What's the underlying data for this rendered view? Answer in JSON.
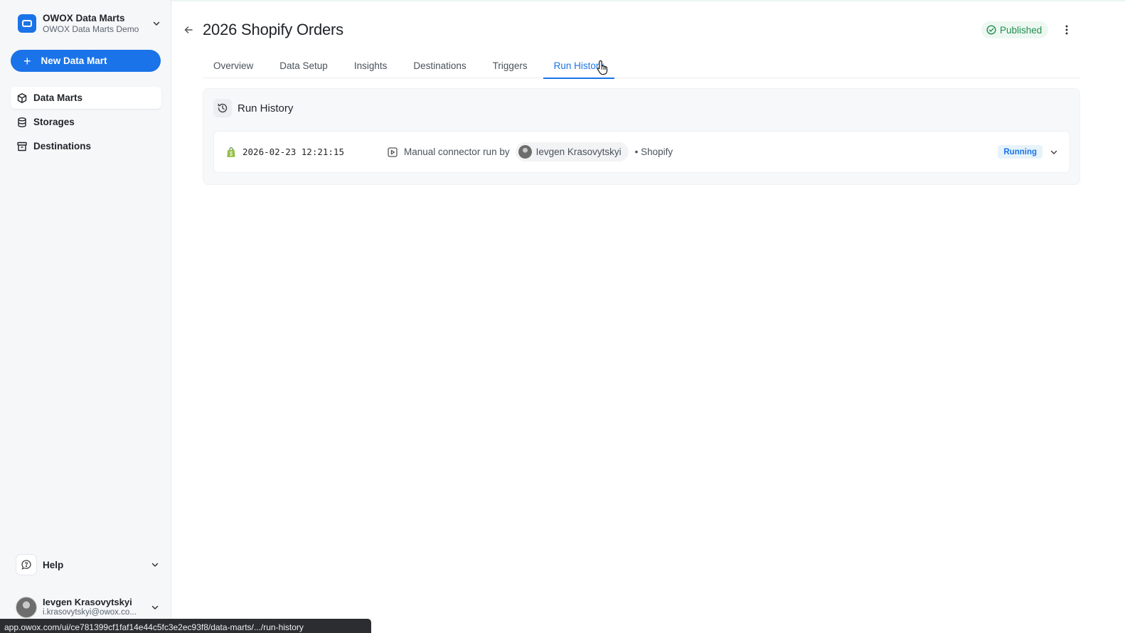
{
  "workspace": {
    "name": "OWOX Data Marts",
    "project": "OWOX Data Marts Demo"
  },
  "sidebar": {
    "new_button_label": "New Data Mart",
    "items": [
      {
        "label": "Data Marts",
        "icon": "cube-icon",
        "active": true
      },
      {
        "label": "Storages",
        "icon": "database-icon",
        "active": false
      },
      {
        "label": "Destinations",
        "icon": "archive-icon",
        "active": false
      }
    ],
    "help_label": "Help"
  },
  "user": {
    "name": "Ievgen Krasovytskyi",
    "email": "i.krasovytskyi@owox.co..."
  },
  "status_url": "app.owox.com/ui/ce781399cf1faf14e44c5fc3e2ec93f8/data-marts/.../run-history",
  "header": {
    "title": "2026 Shopify Orders",
    "status": "Published"
  },
  "tabs": [
    {
      "label": "Overview",
      "active": false
    },
    {
      "label": "Data Setup",
      "active": false
    },
    {
      "label": "Insights",
      "active": false
    },
    {
      "label": "Destinations",
      "active": false
    },
    {
      "label": "Triggers",
      "active": false
    },
    {
      "label": "Run History",
      "active": true
    }
  ],
  "run_history": {
    "title": "Run History",
    "runs": [
      {
        "timestamp": "2026-02-23 12:21:15",
        "description": "Manual connector run by",
        "user": "Ievgen Krasovytskyi",
        "source": "• Shopify",
        "status": "Running"
      }
    ]
  },
  "colors": {
    "accent": "#1a73e8",
    "published": "#1e8e4e",
    "running_bg": "#e6f3fb",
    "shopify": "#95bf47"
  }
}
